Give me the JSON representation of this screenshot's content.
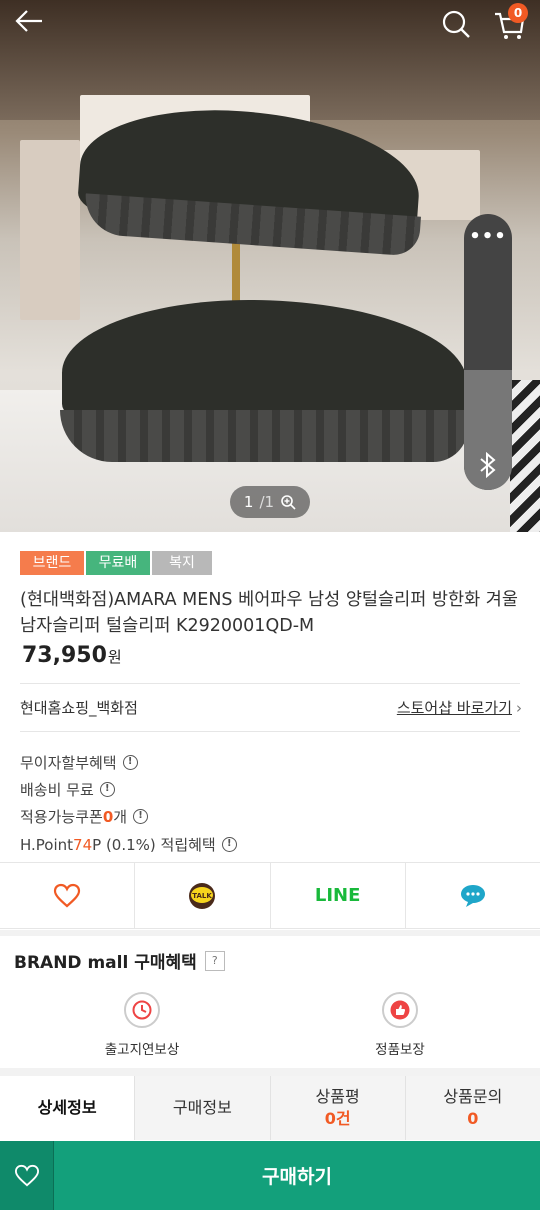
{
  "topbar": {
    "back_icon": "arrow-left-icon",
    "search_icon": "search-icon",
    "cart_icon": "cart-icon",
    "cart_count": "0"
  },
  "gallery": {
    "current": "1",
    "total": "/1",
    "zoom_icon": "zoom-in-icon"
  },
  "overlay_panel": {
    "more": "•••",
    "bluetooth_icon": "bluetooth-icon"
  },
  "badges": [
    "브랜드몰",
    "무료배송",
    "복지"
  ],
  "product": {
    "title": "(현대백화점)AMARA MENS 베어파우 남성 양털슬리퍼 방한화 겨울 남자슬리퍼 털슬리퍼 K2920001QD-M",
    "price": "73,950",
    "price_unit": "원"
  },
  "store": {
    "name": "현대홈쇼핑_백화점",
    "link": "스토어샵 바로가기"
  },
  "benefits": {
    "installment": "무이자할부혜택",
    "shipping": "배송비 무료",
    "coupon_prefix": "적용가능쿠폰 ",
    "coupon_count": "0",
    "coupon_suffix": "개",
    "hpoint_prefix": "H.Point ",
    "hpoint_value": "74",
    "hpoint_suffix": " P (0.1%) 적립혜택"
  },
  "share": [
    "heart-icon",
    "kakaotalk-icon",
    "LINE",
    "chat-bubble-icon"
  ],
  "brand_mall": {
    "title": "BRAND mall 구매혜택",
    "help": "?",
    "items": [
      {
        "icon": "clock-icon",
        "label": "출고지연보상"
      },
      {
        "icon": "thumbs-up-icon",
        "label": "정품보장"
      }
    ]
  },
  "tabs": [
    {
      "label": "상세정보"
    },
    {
      "label": "구매정보"
    },
    {
      "label": "상품평",
      "count": "0건"
    },
    {
      "label": "상품문의",
      "count": "0"
    }
  ],
  "bottom": {
    "buy_label": "구매하기",
    "wish_icon": "heart-icon"
  },
  "colors": {
    "accent_green": "#13a07b",
    "accent_orange": "#f15a24"
  }
}
